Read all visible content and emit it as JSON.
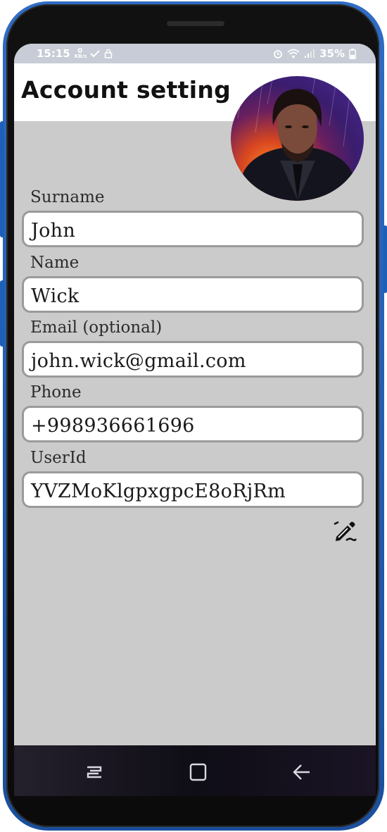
{
  "status_bar": {
    "time": "15:15",
    "net_speed_top": "0",
    "net_speed_unit": "KB/s",
    "battery": "35%"
  },
  "header": {
    "title": "Account setting"
  },
  "profile": {
    "avatar_icon": "profile-photo"
  },
  "fields": [
    {
      "label": "Surname",
      "value": "John"
    },
    {
      "label": "Name",
      "value": "Wick"
    },
    {
      "label": "Email (optional)",
      "value": "john.wick@gmail.com"
    },
    {
      "label": "Phone",
      "value": "+998936661696"
    },
    {
      "label": "UserId",
      "value": "YVZMoKlgpxgpcE8oRjRm"
    }
  ],
  "actions": {
    "edit_icon": "pencil-edit-icon"
  },
  "navigation": {
    "items": [
      "recents",
      "home",
      "back"
    ]
  }
}
